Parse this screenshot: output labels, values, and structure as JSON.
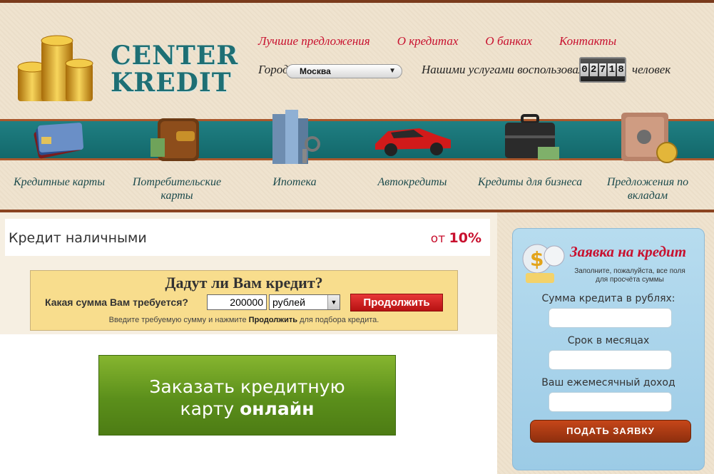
{
  "logo": {
    "line1": "CENTER",
    "line2": "KREDIT"
  },
  "topnav": {
    "items": [
      "Лучшие предложения",
      "О кредитах",
      "О банках",
      "Контакты"
    ]
  },
  "city": {
    "label": "Город",
    "selected": "Москва"
  },
  "users": {
    "label": "Нашими услугами воспользовались",
    "counter_digits": [
      "0",
      "2",
      "7",
      "1",
      "8"
    ],
    "suffix": "человек"
  },
  "categories": [
    {
      "label": "Кредитные карты",
      "icon": "credit-cards-icon"
    },
    {
      "label": "Потребительские карты",
      "icon": "wallet-icon"
    },
    {
      "label": "Ипотека",
      "icon": "buildings-keys-icon"
    },
    {
      "label": "Автокредиты",
      "icon": "car-icon"
    },
    {
      "label": "Кредиты для бизнеса",
      "icon": "briefcase-icon"
    },
    {
      "label": "Предложения по вкладам",
      "icon": "safe-icon"
    }
  ],
  "credit_offer": {
    "title": "Кредит наличными",
    "rate_prefix": "от",
    "rate_value": "10%"
  },
  "loan_form": {
    "title": "Дадут ли Вам кредит?",
    "question": "Какая сумма Вам требуется?",
    "amount_value": "200000",
    "currency_selected": "рублей",
    "continue_label": "Продолжить",
    "hint_before": "Введите требуемую сумму и нажмите",
    "hint_bold": "Продолжить",
    "hint_after": "для подбора кредита."
  },
  "order_card": {
    "line1": "Заказать кредитную",
    "line2_plain": "карту",
    "line2_bold": "онлайн"
  },
  "application": {
    "title": "Заявка на кредит",
    "subtitle": "Заполните, пожалуйста, все поля для просчёта суммы",
    "fields": [
      {
        "label": "Сумма кредита в рублях:",
        "value": ""
      },
      {
        "label": "Срок в месяцах",
        "value": ""
      },
      {
        "label": "Ваш ежемесячный доход",
        "value": ""
      }
    ],
    "submit_label": "ПОДАТЬ ЗАЯВКУ"
  },
  "colors": {
    "accent_red": "#c8102e",
    "teal_band": "#1f7f82",
    "brown_border": "#a9572b",
    "green_button": "#5b8f1b",
    "sidebar_blue": "#b7dcef"
  }
}
